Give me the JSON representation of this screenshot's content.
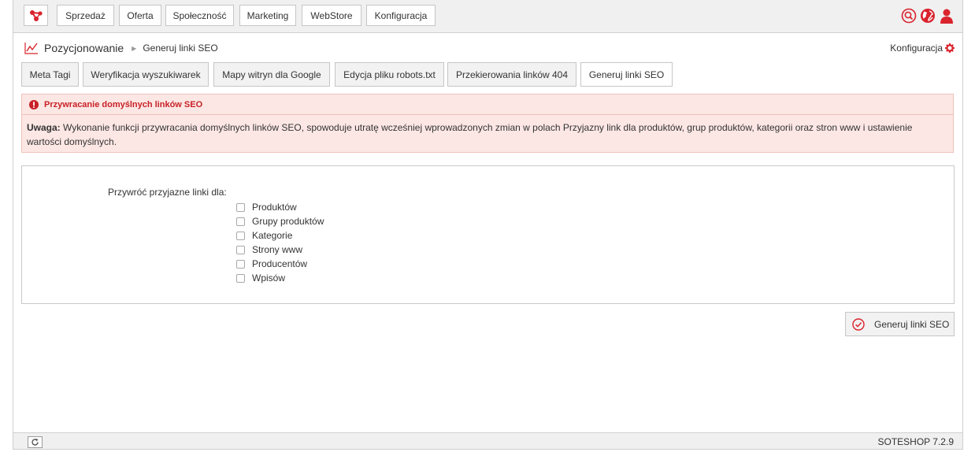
{
  "nav": {
    "logo_icon": "network-nodes-icon",
    "items": [
      "Sprzedaż",
      "Oferta",
      "Społeczność",
      "Marketing",
      "WebStore",
      "Konfiguracja"
    ],
    "right_icons": [
      "search-icon",
      "globe-icon",
      "user-icon"
    ]
  },
  "breadcrumb": {
    "section": "Pozycjonowanie",
    "current": "Generuj linki SEO"
  },
  "config_link": "Konfiguracja",
  "tabs": [
    "Meta Tagi",
    "Weryfikacja wyszukiwarek",
    "Mapy witryn dla Google",
    "Edycja pliku robots.txt",
    "Przekierowania linków 404",
    "Generuj linki SEO"
  ],
  "active_tab": "Generuj linki SEO",
  "alert": {
    "title": "Przywracanie domyślnych linków SEO",
    "body_bold": "Uwaga:",
    "body_text": " Wykonanie funkcji przywracania domyślnych linków SEO, spowoduje utratę wcześniej wprowadzonych zmian w polach Przyjazny link dla produktów, grup produktów, kategorii oraz stron www i ustawienie wartości domyślnych."
  },
  "form": {
    "label": "Przywróć przyjazne linki dla:",
    "options": [
      "Produktów",
      "Grupy produktów",
      "Kategorie",
      "Strony www",
      "Producentów",
      "Wpisów"
    ]
  },
  "submit_label": "Generuj linki SEO",
  "footer": {
    "version": "SOTESHOP 7.2.9"
  },
  "colors": {
    "accent": "#d9232d",
    "alert_bg": "#fce7e4",
    "alert_text": "#c82127"
  }
}
